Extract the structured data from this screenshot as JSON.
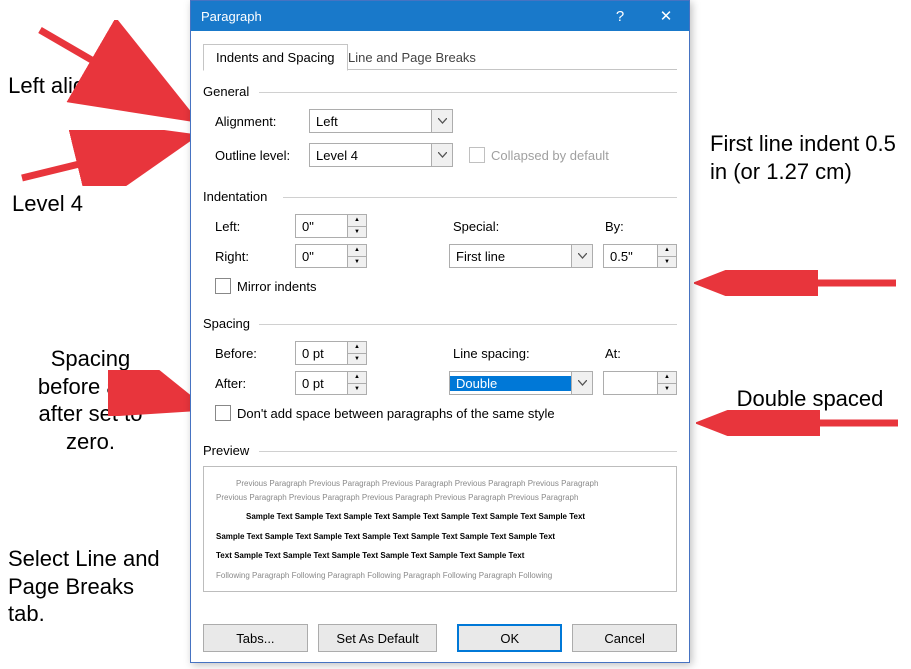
{
  "dialog": {
    "title": "Paragraph",
    "help_glyph": "?",
    "close_glyph": "✕",
    "tabs": [
      "Indents and Spacing",
      "Line and Page Breaks"
    ],
    "general": {
      "label": "General",
      "alignment_label": "Alignment:",
      "alignment_value": "Left",
      "outline_label": "Outline level:",
      "outline_value": "Level 4",
      "collapsed_label": "Collapsed by default"
    },
    "indentation": {
      "label": "Indentation",
      "left_label": "Left:",
      "left_value": "0\"",
      "right_label": "Right:",
      "right_value": "0\"",
      "special_label": "Special:",
      "special_value": "First line",
      "by_label": "By:",
      "by_value": "0.5\"",
      "mirror_label": "Mirror indents"
    },
    "spacing": {
      "label": "Spacing",
      "before_label": "Before:",
      "before_value": "0 pt",
      "after_label": "After:",
      "after_value": "0 pt",
      "line_label": "Line spacing:",
      "line_value": "Double",
      "at_label": "At:",
      "at_value": "",
      "dont_add_label": "Don't add space between paragraphs of the same style"
    },
    "preview": {
      "label": "Preview",
      "prev_line": "Previous Paragraph Previous Paragraph Previous Paragraph Previous Paragraph Previous Paragraph",
      "prev_line2": "Previous Paragraph Previous Paragraph Previous Paragraph Previous Paragraph Previous Paragraph",
      "sample": "Sample Text Sample Text Sample Text Sample Text Sample Text Sample Text Sample Text",
      "sample_short": "Text Sample Text Sample Text Sample Text Sample Text Sample Text Sample Text",
      "follow_line": "Following Paragraph Following Paragraph Following Paragraph Following Paragraph Following"
    },
    "buttons": {
      "tabs": "Tabs...",
      "set_default": "Set As Default",
      "ok": "OK",
      "cancel": "Cancel"
    }
  },
  "annotations": {
    "left_aligned": "Left aligned",
    "level4": "Level 4",
    "spacing_zero": "Spacing before and after set to zero.",
    "select_tab": "Select Line and Page Breaks tab.",
    "first_line": "First line indent 0.5 in (or 1.27 cm)",
    "double_spaced": "Double spaced"
  }
}
